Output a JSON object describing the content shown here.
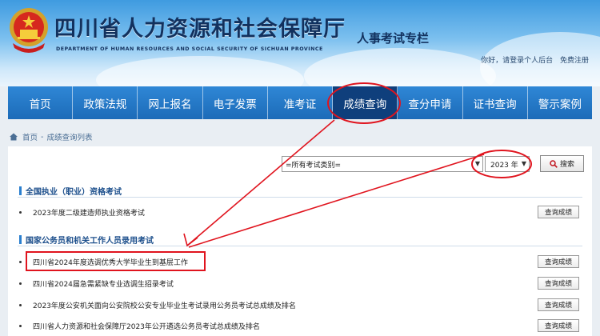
{
  "header": {
    "title": "四川省人力资源和社会保障厅",
    "subtitle": "DEPARTMENT OF HUMAN RESOURCES AND SOCIAL SECURITY OF SICHUAN PROVINCE",
    "section": "人事考试专栏",
    "greeting": "你好，请登录个人后台",
    "register": "免费注册"
  },
  "nav": {
    "items": [
      {
        "label": "首页"
      },
      {
        "label": "政策法规"
      },
      {
        "label": "网上报名"
      },
      {
        "label": "电子发票"
      },
      {
        "label": "准考证"
      },
      {
        "label": "成绩查询"
      },
      {
        "label": "查分申请"
      },
      {
        "label": "证书查询"
      },
      {
        "label": "警示案例"
      }
    ],
    "active": "成绩查询"
  },
  "breadcrumb": {
    "home": "首页",
    "sep": "-",
    "current": "成绩查询列表"
  },
  "filters": {
    "category_value": "=所有考试类别=",
    "year_value": "2023 年",
    "search_label": "搜索"
  },
  "categories": [
    {
      "title": "全国执业（职业）资格考试",
      "rows": [
        {
          "title": "2023年度二级建造师执业资格考试",
          "button": "查询成绩"
        }
      ]
    },
    {
      "title": "国家公务员和机关工作人员录用考试",
      "rows": [
        {
          "title": "四川省2024年度选调优秀大学毕业生到基层工作",
          "button": "查询成绩"
        },
        {
          "title": "四川省2024届急需紧缺专业选调生招录考试",
          "button": "查询成绩"
        },
        {
          "title": "2023年度公安机关面向公安院校公安专业毕业生考试录用公务员考试总成绩及排名",
          "button": "查询成绩"
        },
        {
          "title": "四川省人力资源和社会保障厅2023年公开遴选公务员考试总成绩及排名",
          "button": "查询成绩"
        }
      ]
    }
  ],
  "colors": {
    "nav": "#1c6bb8",
    "nav_active": "#0f3f7c",
    "annotation": "#e0141e",
    "title": "#12315e"
  }
}
